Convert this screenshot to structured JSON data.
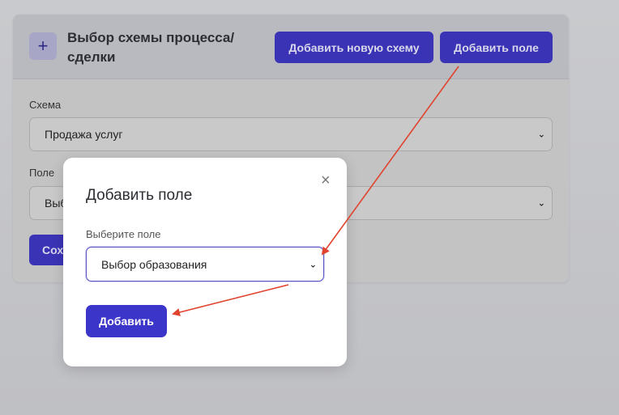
{
  "card": {
    "title": "Выбор схемы процесса/ сделки",
    "plus_symbol": "+",
    "add_scheme_button": "Добавить новую схему",
    "add_field_button": "Добавить поле"
  },
  "form": {
    "scheme_label": "Схема",
    "scheme_value": "Продажа услуг",
    "field_label": "Поле",
    "field_value": "Выб",
    "save_button": "Сох"
  },
  "modal": {
    "title": "Добавить поле",
    "close_symbol": "×",
    "select_label": "Выберите поле",
    "select_value": "Выбор образования",
    "submit_button": "Добавить"
  },
  "colors": {
    "primary": "#3c35c9",
    "annotation_arrow": "#e0442f"
  }
}
